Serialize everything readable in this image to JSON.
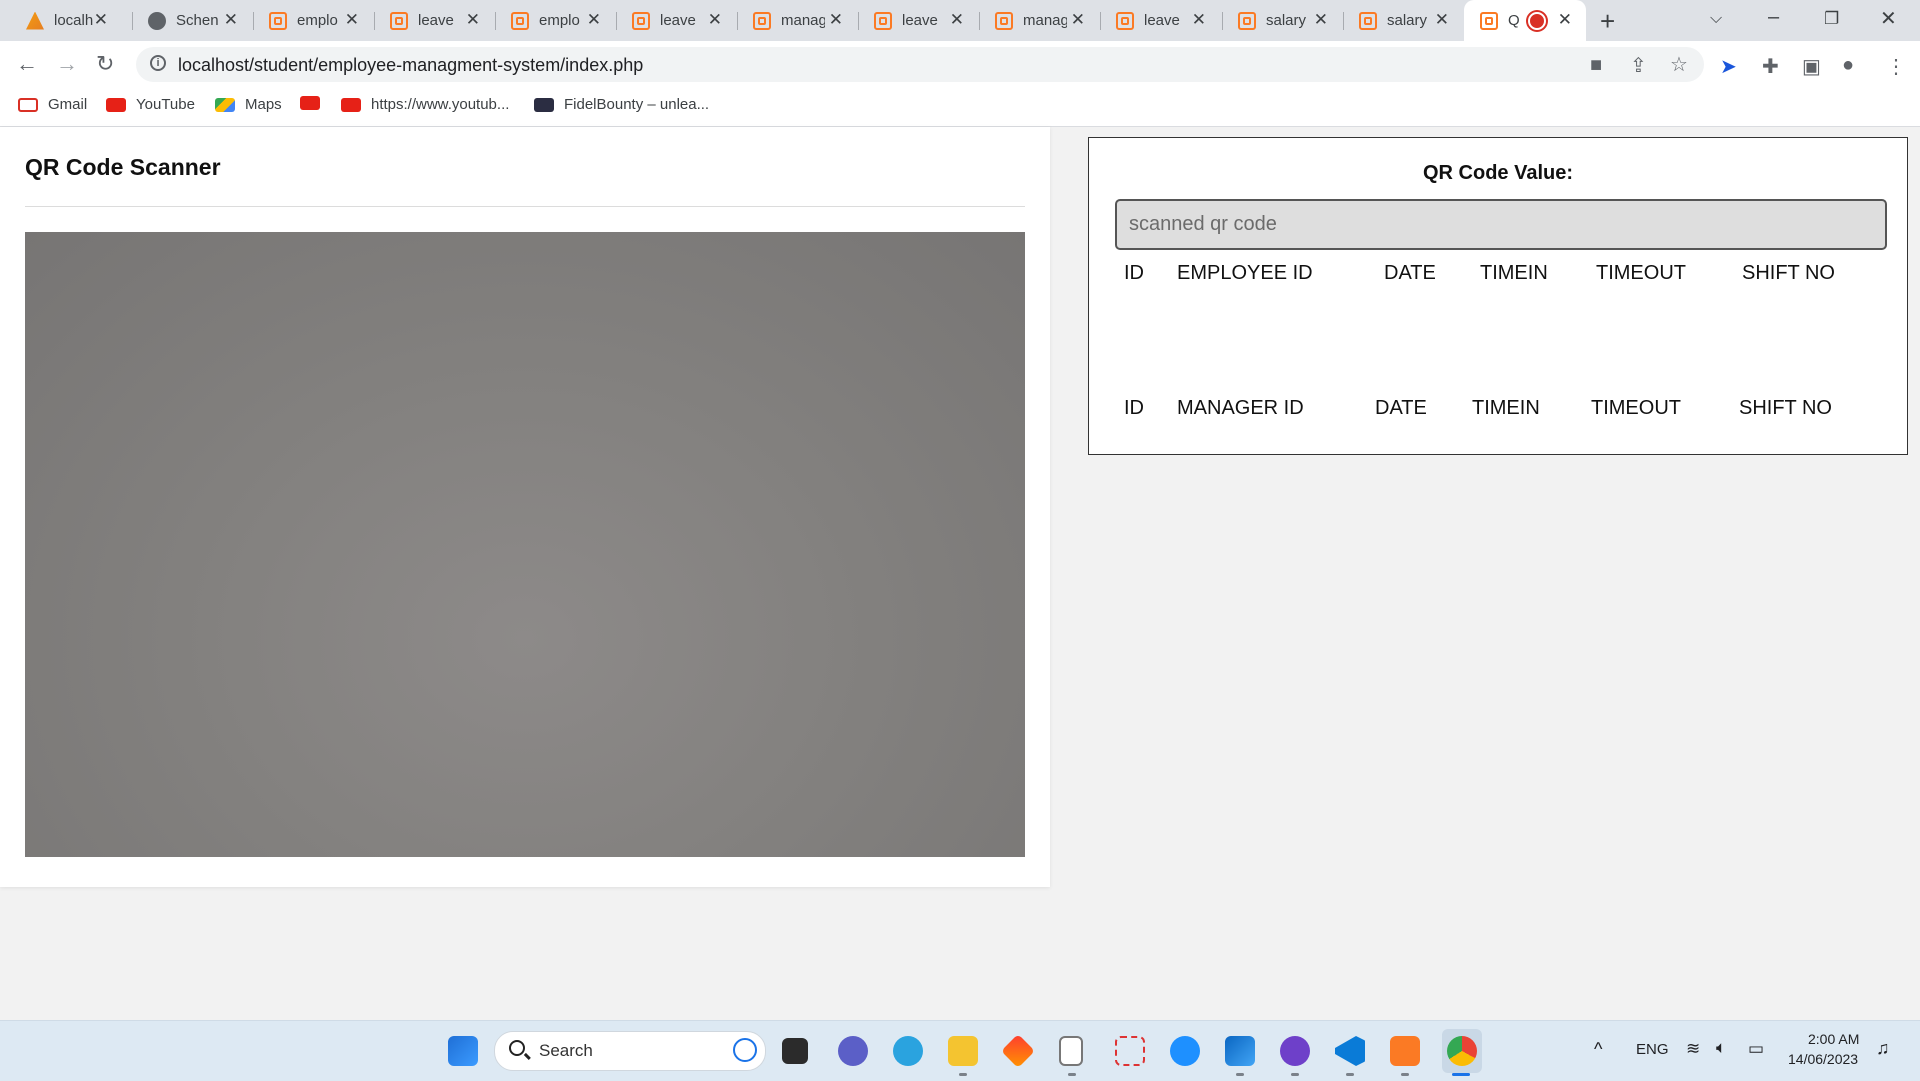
{
  "browser": {
    "tabs": [
      {
        "label": "localh",
        "icon": "phpmyadmin-icon"
      },
      {
        "label": "Schen",
        "icon": "globe-icon"
      },
      {
        "label": "emplo",
        "icon": "xampp-icon"
      },
      {
        "label": "leave",
        "icon": "xampp-icon"
      },
      {
        "label": "emplo",
        "icon": "xampp-icon"
      },
      {
        "label": "leave",
        "icon": "xampp-icon"
      },
      {
        "label": "manag",
        "icon": "xampp-icon"
      },
      {
        "label": "leave",
        "icon": "xampp-icon"
      },
      {
        "label": "manag",
        "icon": "xampp-icon"
      },
      {
        "label": "leave",
        "icon": "xampp-icon"
      },
      {
        "label": "salary",
        "icon": "xampp-icon"
      },
      {
        "label": "salary",
        "icon": "xampp-icon"
      },
      {
        "label": "Q",
        "icon": "xampp-icon",
        "active": true,
        "recording": true
      }
    ],
    "close_glyph": "✕",
    "new_tab_glyph": "+",
    "url": "localhost/student/employee-managment-system/index.php",
    "bookmarks": [
      {
        "label": "Gmail",
        "icon": "gmail-icon"
      },
      {
        "label": "YouTube",
        "icon": "youtube-icon"
      },
      {
        "label": "Maps",
        "icon": "maps-icon"
      },
      {
        "label": "",
        "icon": "youtube-icon"
      },
      {
        "label": "https://www.youtub...",
        "icon": "youtube-icon"
      },
      {
        "label": "FidelBounty – unlea...",
        "icon": "fidelbounty-icon"
      }
    ]
  },
  "scanner": {
    "title": "QR Code Scanner"
  },
  "value_panel": {
    "title": "QR Code Value:",
    "input_placeholder": "scanned qr code",
    "input_value": "",
    "employee_headers": [
      "ID",
      "EMPLOYEE ID",
      "DATE",
      "TIMEIN",
      "TIMEOUT",
      "SHIFT NO"
    ],
    "manager_headers": [
      "ID",
      "MANAGER ID",
      "DATE",
      "TIMEIN",
      "TIMEOUT",
      "SHIFT NO"
    ]
  },
  "taskbar": {
    "search_label": "Search",
    "language": "ENG",
    "time": "2:00 AM",
    "date": "14/06/2023"
  },
  "colors": {
    "accent_xampp": "#fb7a24",
    "camera_feed": "#83817f",
    "taskbar": "#dde9f3"
  }
}
